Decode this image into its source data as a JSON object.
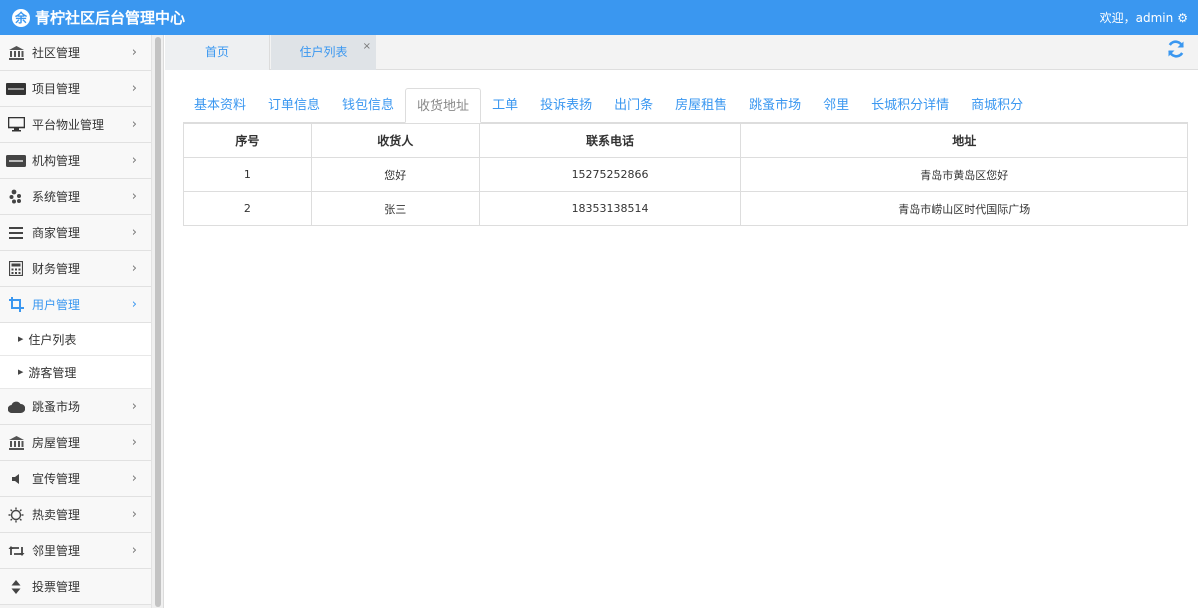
{
  "header": {
    "logo_glyph": "余",
    "title": "青柠社区后台管理中心",
    "welcome": "欢迎，admin",
    "gear_icon": "⚙"
  },
  "sidebar": {
    "items": [
      {
        "label": "社区管理",
        "icon": "bank-icon"
      },
      {
        "label": "项目管理",
        "icon": "card-icon"
      },
      {
        "label": "平台物业管理",
        "icon": "monitor-icon"
      },
      {
        "label": "机构管理",
        "icon": "stripe-icon"
      },
      {
        "label": "系统管理",
        "icon": "yelp-icon"
      },
      {
        "label": "商家管理",
        "icon": "menu-icon"
      },
      {
        "label": "财务管理",
        "icon": "calculator-icon"
      },
      {
        "label": "用户管理",
        "icon": "crop-icon",
        "active": true
      }
    ],
    "subitems": [
      {
        "label": "住户列表"
      },
      {
        "label": "游客管理"
      }
    ],
    "items_after": [
      {
        "label": "跳蚤市场",
        "icon": "cloud-icon"
      },
      {
        "label": "房屋管理",
        "icon": "bank-icon"
      },
      {
        "label": "宣传管理",
        "icon": "volume-icon"
      },
      {
        "label": "热卖管理",
        "icon": "sun-icon"
      },
      {
        "label": "邻里管理",
        "icon": "retweet-icon"
      },
      {
        "label": "投票管理",
        "icon": "sort-icon"
      }
    ]
  },
  "topbar": {
    "tabs": [
      {
        "label": "首页"
      },
      {
        "label": "住户列表",
        "close": "×"
      }
    ]
  },
  "subtabs": [
    {
      "label": "基本资料"
    },
    {
      "label": "订单信息"
    },
    {
      "label": "钱包信息"
    },
    {
      "label": "收货地址",
      "active": true
    },
    {
      "label": "工单"
    },
    {
      "label": "投诉表扬"
    },
    {
      "label": "出门条"
    },
    {
      "label": "房屋租售"
    },
    {
      "label": "跳蚤市场"
    },
    {
      "label": "邻里"
    },
    {
      "label": "长城积分详情"
    },
    {
      "label": "商城积分"
    }
  ],
  "table": {
    "columns": [
      "序号",
      "收货人",
      "联系电话",
      "地址"
    ],
    "rows": [
      [
        "1",
        "您好",
        "15275252866",
        "青岛市黄岛区您好"
      ],
      [
        "2",
        "张三",
        "18353138514",
        "青岛市崂山区时代国际广场"
      ]
    ]
  }
}
